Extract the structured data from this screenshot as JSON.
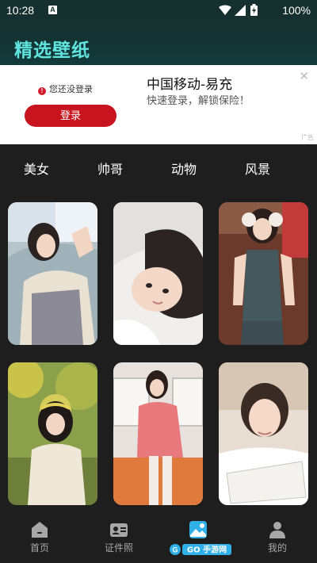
{
  "status_bar": {
    "time": "10:28",
    "notification_icon": "A",
    "battery": "100%"
  },
  "header": {
    "title": "精选壁纸"
  },
  "ad": {
    "warning_text": "您还没登录",
    "login_button": "登录",
    "title": "中国移动-易充",
    "subtitle": "快速登录，解锁保险！",
    "close_symbol": "✕",
    "tag": "广告"
  },
  "categories": [
    "美女",
    "帅哥",
    "动物",
    "风景"
  ],
  "wallpapers": [
    {
      "name": "girl-pillow-photo"
    },
    {
      "name": "girl-lying-photo"
    },
    {
      "name": "girl-earmuffs-photo"
    },
    {
      "name": "girl-autumn-photo"
    },
    {
      "name": "girl-pink-sweater-photo"
    },
    {
      "name": "girl-book-photo"
    }
  ],
  "bottom_nav": [
    {
      "label": "首页",
      "icon": "home-icon"
    },
    {
      "label": "证件照",
      "icon": "id-card-icon"
    },
    {
      "label": "",
      "icon": "wallpaper-icon",
      "active": true
    },
    {
      "label": "我的",
      "icon": "user-icon"
    }
  ],
  "watermark": "GO 手游网",
  "colors": {
    "accent": "#5fe4e0",
    "active_nav": "#2fb0e8",
    "ad_button": "#c8141f"
  }
}
